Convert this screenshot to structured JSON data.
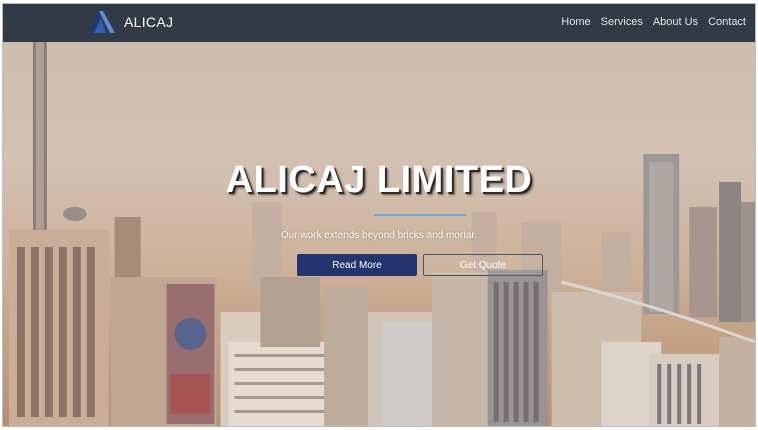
{
  "brand": {
    "name": "ALICAJ",
    "logo": "alicaj-logo"
  },
  "nav": {
    "links": [
      "Home",
      "Services",
      "About Us",
      "Contact"
    ]
  },
  "hero": {
    "title": "ALICAJ LIMITED",
    "tagline": "Our work extends beyond bricks and mortar.",
    "primary_button": "Read More",
    "secondary_button": "Get Quote",
    "background": "city-skyline-photo"
  },
  "colors": {
    "navbar": "#323a45",
    "accent": "#6fa8d8",
    "primary_button": "#23356f"
  }
}
